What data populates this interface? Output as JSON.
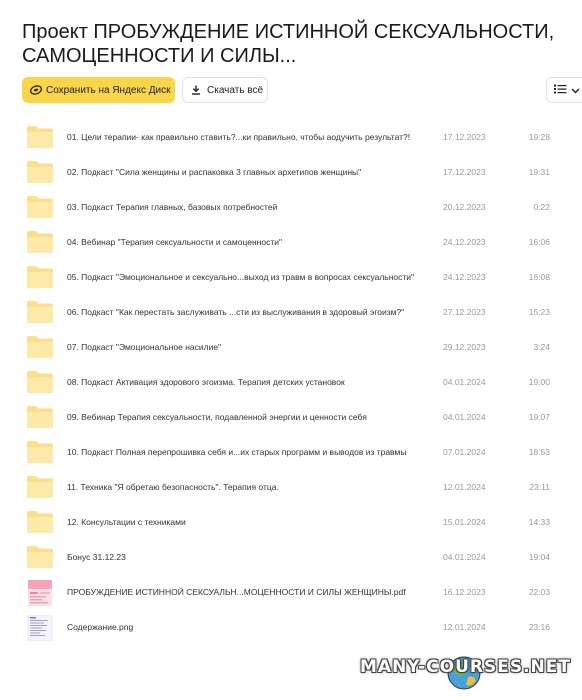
{
  "header": {
    "title": "Проект ПРОБУЖДЕНИЕ ИСТИННОЙ СЕКСУАЛЬНОСТИ, САМОЦЕННОСТИ И СИЛЫ..."
  },
  "toolbar": {
    "save_label": "Сохранить на Яндекс Диск",
    "download_label": "Скачать всё",
    "save_color": "#f9d54a"
  },
  "files": [
    {
      "name": "01. Цели терапии- как правильно ставить?...ки правильно, чтобы аодучить результат?!",
      "date": "17.12.2023",
      "time": "19:28",
      "type": "folder"
    },
    {
      "name": "02. Подкаст \"Сила женщины и распаковка 3 главных архетипов женщины\"",
      "date": "17.12.2023",
      "time": "19:31",
      "type": "folder"
    },
    {
      "name": "03. Подкаст Терапия главных, базовых потребностей",
      "date": "20.12.2023",
      "time": "0:22",
      "type": "folder"
    },
    {
      "name": "04. Вебинар \"Терапия сексуальности и самоценности\"",
      "date": "24.12.2023",
      "time": "16:06",
      "type": "folder"
    },
    {
      "name": "05. Подкаст \"Эмоциональное и сексуально...выход из травм в вопросах сексуальности\"",
      "date": "24.12.2023",
      "time": "16:08",
      "type": "folder"
    },
    {
      "name": "06. Подкаст \"Как перестать заслуживать ...сти из выслуживания в здоровый эгоизм?\"",
      "date": "27.12.2023",
      "time": "15:23",
      "type": "folder"
    },
    {
      "name": "07. Подкаст \"Эмоциональное насилие\"",
      "date": "29.12.2023",
      "time": "3:24",
      "type": "folder"
    },
    {
      "name": "08. Подкаст Активация здорового эгоизма. Терапия детских установок",
      "date": "04.01.2024",
      "time": "19:00",
      "type": "folder"
    },
    {
      "name": "09. Вебинар Терапия сексуальности, подавленной энергии и ценности себя",
      "date": "04.01.2024",
      "time": "19:07",
      "type": "folder"
    },
    {
      "name": "10. Подкаст Полная перепрошивка себя и...их старых программ и выводов из травмы",
      "date": "07.01.2024",
      "time": "18:53",
      "type": "folder"
    },
    {
      "name": "11. Техника \"Я обретаю безопасность\". Терапия отца.",
      "date": "12.01.2024",
      "time": "23:11",
      "type": "folder"
    },
    {
      "name": "12. Консультации с техниками",
      "date": "15.01.2024",
      "time": "14:33",
      "type": "folder"
    },
    {
      "name": "Бонус 31.12.23",
      "date": "04.01.2024",
      "time": "19:04",
      "type": "folder"
    },
    {
      "name": "ПРОБУЖДЕНИЕ ИСТИННОЙ СЕКСУАЛЬН...МОЦЕННОСТИ И СИЛЫ ЖЕНЩИНЫ.pdf",
      "date": "16.12.2023",
      "time": "22:03",
      "type": "pdf"
    },
    {
      "name": "Содержание.png",
      "date": "12.01.2024",
      "time": "23:16",
      "type": "png"
    }
  ],
  "watermark": {
    "text": "MANY-COURSES.NET"
  }
}
